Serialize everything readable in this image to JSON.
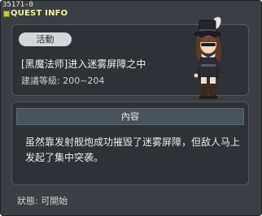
{
  "window": {
    "quest_id": "35171-0",
    "title": "QUEST INFO"
  },
  "quest": {
    "tag": "活動",
    "name": "[黑魔法师]进入迷雾屏障之中",
    "level": "建議等級: 200~204"
  },
  "content": {
    "header": "內容",
    "description": "虽然靠发射舰炮成功摧毁了迷雾屏障，但敌人马上发起了集中突袭。"
  },
  "footer": {
    "status": "狀態:  可開始"
  }
}
